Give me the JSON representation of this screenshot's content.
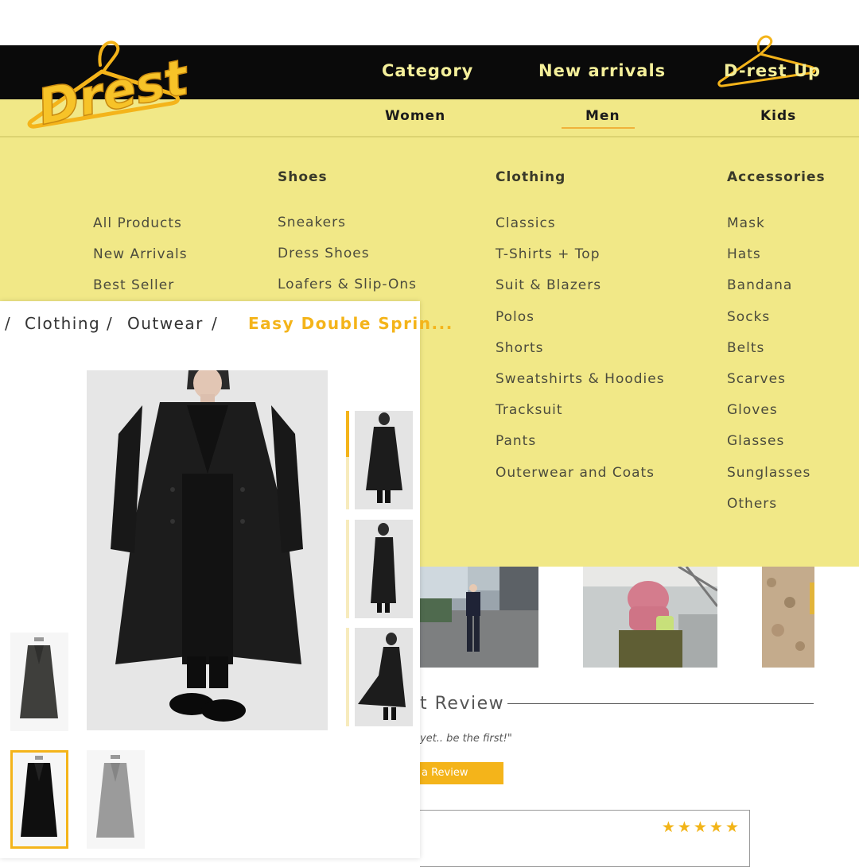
{
  "brand": {
    "logo_text": "Drest",
    "colors": {
      "primary_yellow": "#f1e887",
      "accent": "#f4b41a",
      "header_bg": "#0a0a0a",
      "nav_text": "#f4ef9a"
    }
  },
  "header": {
    "nav": [
      {
        "label": "Category"
      },
      {
        "label": "New arrivals"
      },
      {
        "label": "D-rest Up"
      }
    ]
  },
  "subnav": {
    "items": [
      {
        "label": "Women"
      },
      {
        "label": "Men",
        "active": true
      },
      {
        "label": "Kids"
      }
    ]
  },
  "mega_menu": {
    "general": [
      "All Products",
      "New Arrivals",
      "Best Seller"
    ],
    "shoes": {
      "title": "Shoes",
      "items": [
        "Sneakers",
        "Dress Shoes",
        "Loafers & Slip-Ons"
      ]
    },
    "clothing": {
      "title": "Clothing",
      "items": [
        "Classics",
        "T-Shirts + Top",
        "Suit & Blazers",
        "Polos",
        "Shorts",
        "Sweatshirts & Hoodies",
        "Tracksuit",
        "Pants",
        "Outerwear and Coats"
      ]
    },
    "accessories": {
      "title": "Accessories",
      "items": [
        "Mask",
        "Hats",
        "Bandana",
        "Socks",
        "Belts",
        "Scarves",
        "Gloves",
        "Glasses",
        "Sunglasses",
        "Others"
      ]
    }
  },
  "product": {
    "breadcrumb": {
      "separator": "/",
      "items": [
        "Clothing",
        "Outwear"
      ],
      "current": "Easy Double Sprin..."
    },
    "variants": {
      "selected_index": 1
    }
  },
  "reviews": {
    "title": "t Review",
    "empty_text": "yet.. be the first!\"",
    "write_button": "a Review",
    "rating": 5,
    "stars": "★★★★★"
  }
}
